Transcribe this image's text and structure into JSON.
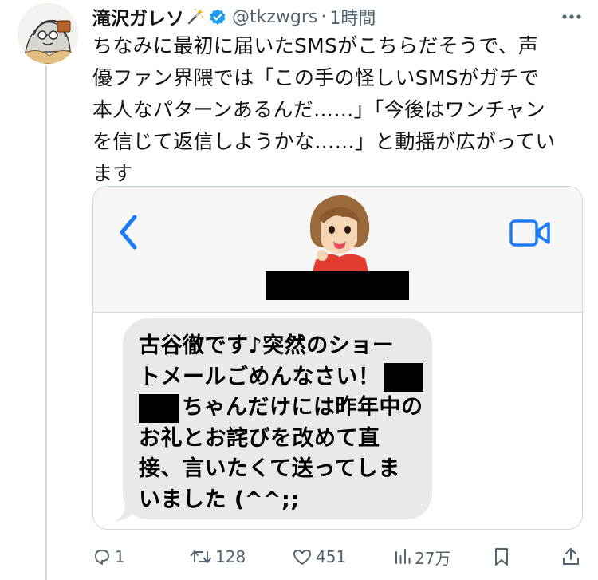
{
  "tweet": {
    "display_name": "滝沢ガレソ",
    "handle": "@tkzwgrs",
    "separator": "·",
    "timestamp": "1時間",
    "text_lines": [
      "ちなみに最初に届いたSMSがこちらだそうで、声",
      "優ファン界隈では「この手の怪しいSMSがガチで",
      "本人なパターンあるんだ……」「今後はワンチャン",
      "を信じて返信しようかな……」と動揺が広がってい",
      "ます"
    ]
  },
  "sms": {
    "line1": "古谷徹です♪突然のショー",
    "line2": "トメールごめんなさい！",
    "line3": "ちゃんだけには昨年中の",
    "line4": "お礼とお詫びを改めて直",
    "line5": "接、言いたくて送ってしま",
    "line6": "いました (^^;;"
  },
  "actions": {
    "reply_count": "1",
    "retweet_count": "128",
    "like_count": "451",
    "views_count": "27万"
  },
  "colors": {
    "accent_blue": "#1d9bf0",
    "ios_blue": "#1a7cf5",
    "secondary_text": "#536471",
    "bubble_gray": "#e9e9eb"
  },
  "icons": [
    "wand-icon",
    "verified-icon",
    "more-icon",
    "back-icon",
    "video-call-icon",
    "reply-icon",
    "retweet-icon",
    "like-icon",
    "views-icon",
    "bookmark-icon",
    "share-icon"
  ]
}
